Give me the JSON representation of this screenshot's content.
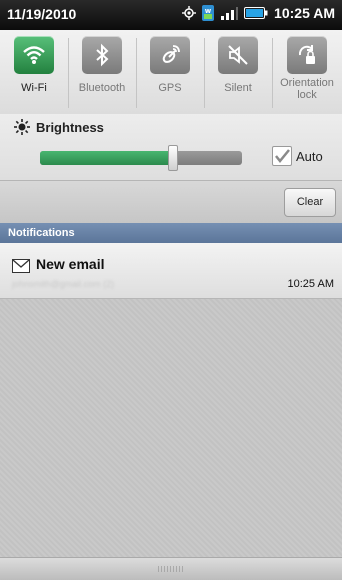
{
  "status_bar": {
    "date": "11/19/2010",
    "time": "10:25 AM",
    "icons": [
      "gps-icon",
      "wifi-badge-icon",
      "signal-icon",
      "battery-icon"
    ]
  },
  "quick_settings": {
    "items": [
      {
        "label": "Wi-Fi",
        "icon": "wifi-icon",
        "active": true
      },
      {
        "label": "Bluetooth",
        "icon": "bluetooth-icon",
        "active": false
      },
      {
        "label": "GPS",
        "icon": "gps-icon",
        "active": false
      },
      {
        "label": "Silent",
        "icon": "silent-icon",
        "active": false
      },
      {
        "label": "Orientation lock",
        "icon": "orientation-lock-icon",
        "active": false
      }
    ]
  },
  "brightness": {
    "label": "Brightness",
    "level": 0.66,
    "auto_label": "Auto",
    "auto_checked": true
  },
  "clear_button": {
    "label": "Clear"
  },
  "notifications": {
    "header": "Notifications",
    "items": [
      {
        "title": "New email",
        "subtitle": "johnsmith@gmail.com (2)",
        "time": "10:25 AM",
        "icon": "email-icon"
      }
    ]
  },
  "colors": {
    "accent_green": "#2c8a4d",
    "header_blue": "#5b7599"
  }
}
